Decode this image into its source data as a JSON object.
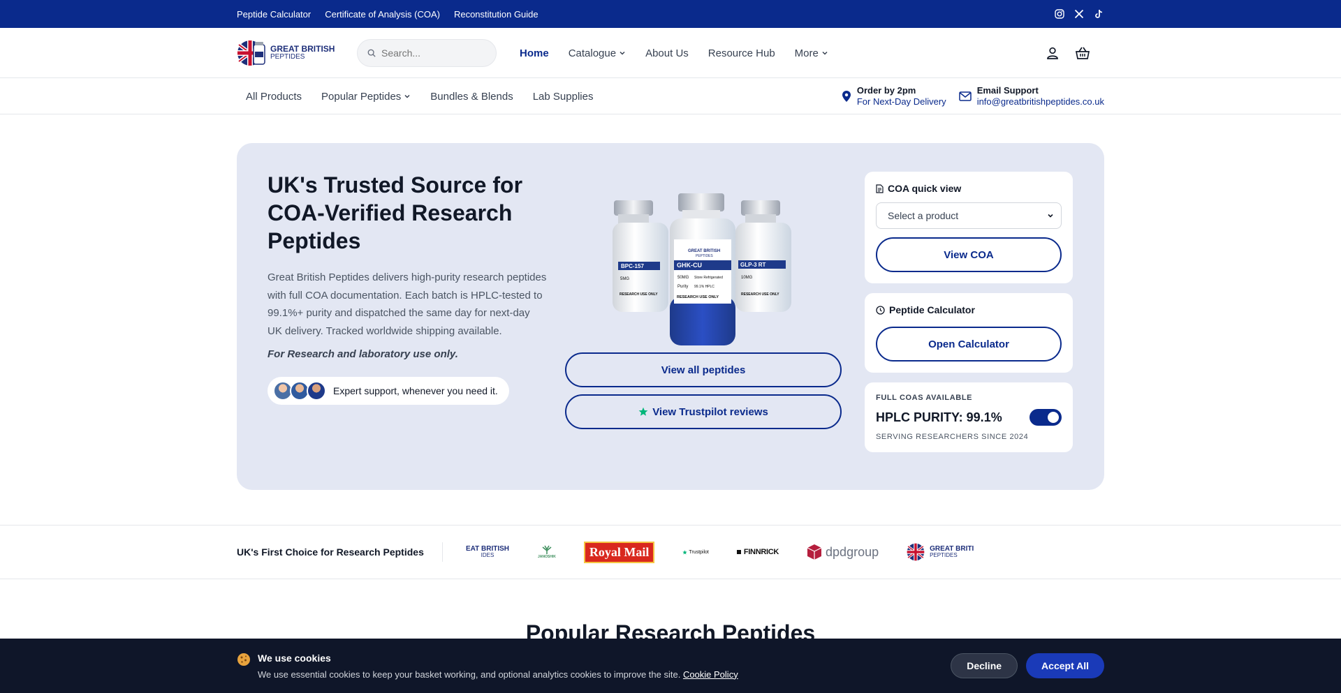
{
  "topbar": {
    "links": [
      "Peptide Calculator",
      "Certificate of Analysis (COA)",
      "Reconstitution Guide"
    ],
    "social": [
      "instagram-icon",
      "x-icon",
      "tiktok-icon"
    ]
  },
  "header": {
    "logo": {
      "line1": "GREAT BRITISH",
      "line2": "PEPTIDES"
    },
    "search_placeholder": "Search...",
    "nav": [
      {
        "label": "Home",
        "active": true
      },
      {
        "label": "Catalogue",
        "dropdown": true
      },
      {
        "label": "About Us"
      },
      {
        "label": "Resource Hub"
      },
      {
        "label": "More",
        "dropdown": true
      }
    ],
    "icons": [
      "user-icon",
      "basket-icon"
    ]
  },
  "subnav": {
    "categories": [
      {
        "label": "All Products"
      },
      {
        "label": "Popular Peptides",
        "dropdown": true
      },
      {
        "label": "Bundles & Blends"
      },
      {
        "label": "Lab Supplies"
      }
    ],
    "order": {
      "title": "Order by 2pm",
      "sub": "For Next-Day Delivery"
    },
    "email": {
      "title": "Email Support",
      "sub": "info@greatbritishpeptides.co.uk"
    }
  },
  "hero": {
    "title": "UK's Trusted Source for COA-Verified Research Peptides",
    "description": "Great British Peptides delivers high-purity research peptides with full COA documentation. Each batch is HPLC-tested to 99.1%+ purity and dispatched the same day for next-day UK delivery. Tracked worldwide shipping available.",
    "note": "For Research and laboratory use only.",
    "support_text": "Expert support, whenever you need it.",
    "vials": [
      {
        "name": "BPC-157",
        "dose": "5MG"
      },
      {
        "name": "GHK-CU",
        "dose": "50MG"
      },
      {
        "name": "GLP-3 RT",
        "dose": "10MG"
      }
    ],
    "vial_label": {
      "brand1": "GREAT BRITISH",
      "brand2": "PEPTIDES",
      "store": "Store Refrigerated",
      "purity": "Purity",
      "purity_val": "99.1% HPLC",
      "ruo": "RESEARCH USE ONLY"
    },
    "btn_all": "View all peptides",
    "btn_trustpilot": "View Trustpilot reviews"
  },
  "coa_card": {
    "title": "COA quick view",
    "select_value": "Select a product",
    "button": "View COA"
  },
  "calc_card": {
    "title": "Peptide Calculator",
    "button": "Open Calculator"
  },
  "purity_card": {
    "label": "FULL COAS AVAILABLE",
    "value": "HPLC PURITY: 99.1%",
    "toggle_on": true,
    "since": "SERVING RESEARCHERS SINCE 2024"
  },
  "strip": {
    "title": "UK's First Choice for Research Peptides",
    "logos": {
      "gbp_partial": "EAT BRITISH",
      "gbp_partial_sub": "IDES",
      "janoshik": "JANOSHIK",
      "royalmail": "Royal Mail",
      "trustpilot": "Trustpilot",
      "finnrick": "FINNRICK",
      "dpd": "dpdgroup",
      "gbp_end": "GREAT BRITI",
      "gbp_end_sub": "PEPTIDES"
    }
  },
  "section_title": "Popular Research Peptides",
  "cookie": {
    "title": "We use cookies",
    "body": "We use essential cookies to keep your basket working, and optional analytics cookies to improve the site.",
    "link": "Cookie Policy",
    "decline": "Decline",
    "accept": "Accept All"
  },
  "colors": {
    "brand_navy": "#0a2a8c",
    "hero_bg": "#e3e7f3",
    "cookie_bg": "#0f1629",
    "accept": "#1a3ab8",
    "trustpilot_green": "#00b67a",
    "royalmail_red": "#d9281e"
  }
}
